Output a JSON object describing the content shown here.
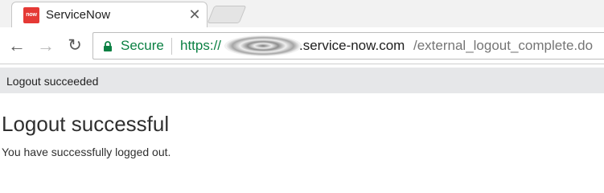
{
  "browser": {
    "tab": {
      "favicon_text": "now",
      "title": "ServiceNow",
      "close_glyph": "✕"
    },
    "nav": {
      "back_glyph": "←",
      "forward_glyph": "→",
      "reload_glyph": "↻"
    },
    "address_bar": {
      "security_label": "Secure",
      "scheme": "https://",
      "host": ".service-now.com",
      "path": "/external_logout_complete.do"
    }
  },
  "page": {
    "header_title": "Logout succeeded",
    "heading": "Logout successful",
    "message": "You have successfully logged out."
  },
  "colors": {
    "secure_green": "#0b8043",
    "favicon_red": "#e53935",
    "header_bar": "#e6e7e9"
  },
  "icons": {
    "favicon": "servicenow-logo",
    "lock": "lock-icon",
    "back": "back-arrow-icon",
    "forward": "forward-arrow-icon",
    "reload": "reload-icon",
    "close": "close-icon"
  }
}
